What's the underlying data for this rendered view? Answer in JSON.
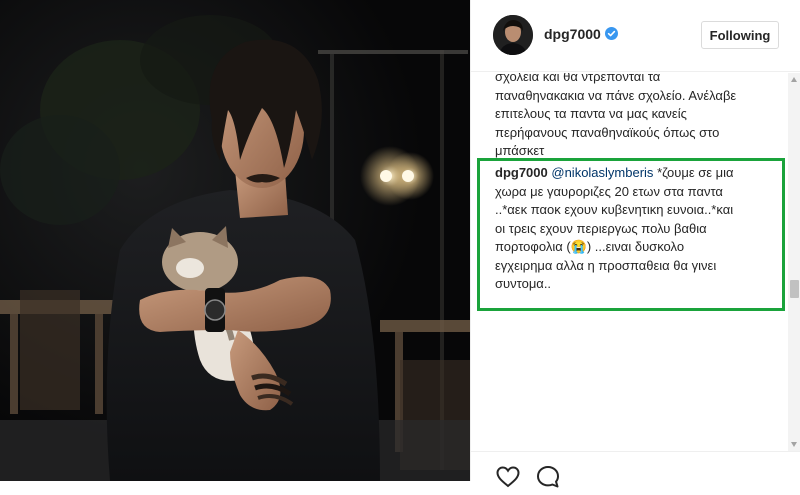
{
  "post": {
    "username": "dpg7000",
    "verified": true,
    "follow_label": "Following"
  },
  "comments": [
    {
      "author": "",
      "lines": [
        "σχολεια και θα ντρεπονται τα",
        "παναθηνακακια να πάνε σχολείο. Ανέλαβε",
        "επιτελους τα παντα να μας κανείς",
        "περήφανους παναθηναϊκούς όπως στο",
        "μπάσκετ"
      ]
    },
    {
      "author": "dpg7000",
      "mention": "@nikolaslymberis",
      "first_line_rest": "*ζουμε σε μια",
      "lines": [
        "χωρα με γαυροριζες 20 ετων στα παντα",
        "..*αεκ παοκ εχουν κυβενητικη ευνοια..*και",
        "οι τρεις εχουν περιεργως πολυ βαθια",
        "πορτοφολια (😭) ...ειναι δυσκολο",
        "εγχειρημα αλλα η προσπαθεια θα γινει",
        "συντομα.."
      ]
    }
  ],
  "colors": {
    "verified_badge": "#3897f0",
    "highlight_border": "#1aa33b",
    "mention": "#003569"
  },
  "icons": {
    "like": "heart-icon",
    "comment": "comment-bubble-icon",
    "verified": "verified-badge-icon"
  }
}
